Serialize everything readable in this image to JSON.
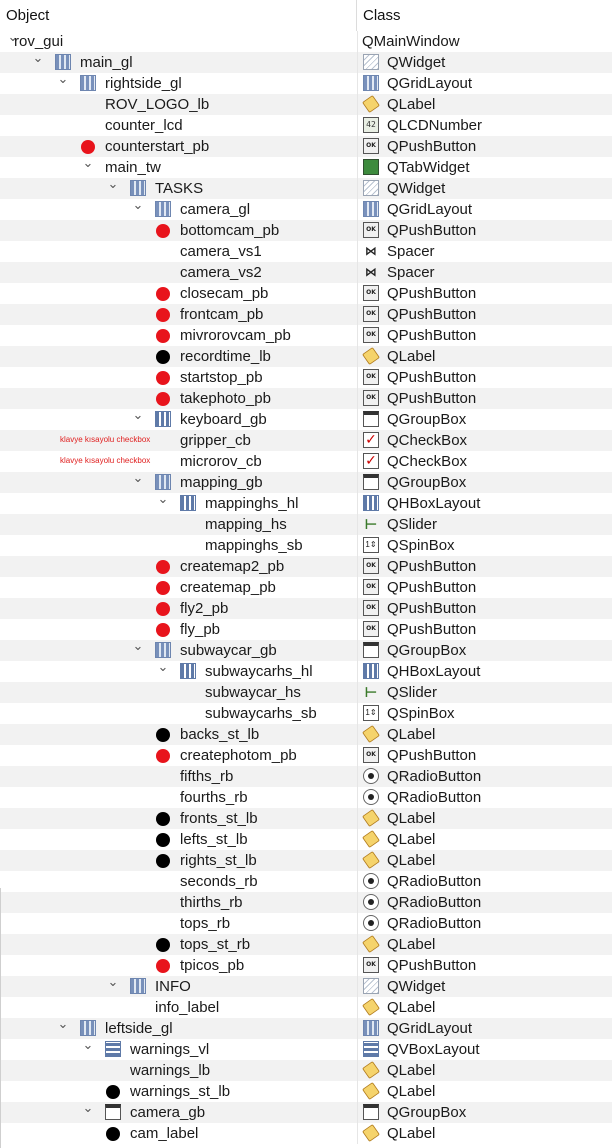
{
  "header": {
    "object_label": "Object",
    "class_label": "Class"
  },
  "colors": {
    "red_marker": "#e8141c",
    "black_marker": "#000000",
    "annotation": "#e02020"
  },
  "rows": [
    {
      "name": "rov_gui",
      "cls": "QMainWindow",
      "depth": 0,
      "expand": "v",
      "icon": "none",
      "mark": "",
      "anno": ""
    },
    {
      "name": "main_gl",
      "cls": "QWidget",
      "depth": 1,
      "expand": "v",
      "icon": "grid-layout-icon",
      "cicon": "widget",
      "mark": "",
      "anno": ""
    },
    {
      "name": "rightside_gl",
      "cls": "QGridLayout",
      "depth": 2,
      "expand": "v",
      "icon": "grid-layout-icon",
      "cicon": "grid",
      "mark": "",
      "anno": ""
    },
    {
      "name": "ROV_LOGO_lb",
      "cls": "QLabel",
      "depth": 3,
      "expand": "",
      "icon": "",
      "cicon": "label",
      "mark": "",
      "anno": ""
    },
    {
      "name": "counter_lcd",
      "cls": "QLCDNumber",
      "depth": 3,
      "expand": "",
      "icon": "",
      "cicon": "lcd",
      "mark": "",
      "anno": ""
    },
    {
      "name": "counterstart_pb",
      "cls": "QPushButton",
      "depth": 3,
      "expand": "",
      "icon": "",
      "cicon": "button",
      "mark": "red",
      "anno": ""
    },
    {
      "name": "main_tw",
      "cls": "QTabWidget",
      "depth": 3,
      "expand": "v",
      "icon": "",
      "cicon": "tab",
      "mark": "",
      "anno": ""
    },
    {
      "name": "TASKS",
      "cls": "QWidget",
      "depth": 4,
      "expand": "v",
      "icon": "grid-layout-icon",
      "cicon": "widget",
      "mark": "",
      "anno": ""
    },
    {
      "name": "camera_gl",
      "cls": "QGridLayout",
      "depth": 5,
      "expand": "v",
      "icon": "grid-layout-icon",
      "cicon": "grid",
      "mark": "",
      "anno": ""
    },
    {
      "name": "bottomcam_pb",
      "cls": "QPushButton",
      "depth": 6,
      "expand": "",
      "icon": "",
      "cicon": "button",
      "mark": "red",
      "anno": ""
    },
    {
      "name": "camera_vs1",
      "cls": "Spacer",
      "depth": 6,
      "expand": "",
      "icon": "",
      "cicon": "spacer",
      "mark": "",
      "anno": ""
    },
    {
      "name": "camera_vs2",
      "cls": "Spacer",
      "depth": 6,
      "expand": "",
      "icon": "",
      "cicon": "spacer",
      "mark": "",
      "anno": ""
    },
    {
      "name": "closecam_pb",
      "cls": "QPushButton",
      "depth": 6,
      "expand": "",
      "icon": "",
      "cicon": "button",
      "mark": "red",
      "anno": ""
    },
    {
      "name": "frontcam_pb",
      "cls": "QPushButton",
      "depth": 6,
      "expand": "",
      "icon": "",
      "cicon": "button",
      "mark": "red",
      "anno": ""
    },
    {
      "name": "mivrorovcam_pb",
      "cls": "QPushButton",
      "depth": 6,
      "expand": "",
      "icon": "",
      "cicon": "button",
      "mark": "red",
      "anno": ""
    },
    {
      "name": "recordtime_lb",
      "cls": "QLabel",
      "depth": 6,
      "expand": "",
      "icon": "",
      "cicon": "label",
      "mark": "black",
      "anno": ""
    },
    {
      "name": "startstop_pb",
      "cls": "QPushButton",
      "depth": 6,
      "expand": "",
      "icon": "",
      "cicon": "button",
      "mark": "red",
      "anno": ""
    },
    {
      "name": "takephoto_pb",
      "cls": "QPushButton",
      "depth": 6,
      "expand": "",
      "icon": "",
      "cicon": "button",
      "mark": "red",
      "anno": ""
    },
    {
      "name": "keyboard_gb",
      "cls": "QGroupBox",
      "depth": 5,
      "expand": "v",
      "icon": "hbox-layout-icon",
      "cicon": "groupbox",
      "mark": "",
      "anno": ""
    },
    {
      "name": "gripper_cb",
      "cls": "QCheckBox",
      "depth": 6,
      "expand": "",
      "icon": "",
      "cicon": "check",
      "mark": "",
      "anno": "klavye kısayolu checkbox"
    },
    {
      "name": "microrov_cb",
      "cls": "QCheckBox",
      "depth": 6,
      "expand": "",
      "icon": "",
      "cicon": "check",
      "mark": "",
      "anno": "klavye kısayolu checkbox"
    },
    {
      "name": "mapping_gb",
      "cls": "QGroupBox",
      "depth": 5,
      "expand": "v",
      "icon": "grid-layout-icon",
      "cicon": "groupbox",
      "mark": "",
      "anno": ""
    },
    {
      "name": "mappinghs_hl",
      "cls": "QHBoxLayout",
      "depth": 6,
      "expand": "v",
      "icon": "hbox-layout-icon",
      "cicon": "hbox",
      "mark": "",
      "anno": ""
    },
    {
      "name": "mapping_hs",
      "cls": "QSlider",
      "depth": 7,
      "expand": "",
      "icon": "",
      "cicon": "slider",
      "mark": "",
      "anno": ""
    },
    {
      "name": "mappinghs_sb",
      "cls": "QSpinBox",
      "depth": 7,
      "expand": "",
      "icon": "",
      "cicon": "spin",
      "mark": "",
      "anno": ""
    },
    {
      "name": "createmap2_pb",
      "cls": "QPushButton",
      "depth": 6,
      "expand": "",
      "icon": "",
      "cicon": "button",
      "mark": "red",
      "anno": ""
    },
    {
      "name": "createmap_pb",
      "cls": "QPushButton",
      "depth": 6,
      "expand": "",
      "icon": "",
      "cicon": "button",
      "mark": "red",
      "anno": ""
    },
    {
      "name": "fly2_pb",
      "cls": "QPushButton",
      "depth": 6,
      "expand": "",
      "icon": "",
      "cicon": "button",
      "mark": "red",
      "anno": ""
    },
    {
      "name": "fly_pb",
      "cls": "QPushButton",
      "depth": 6,
      "expand": "",
      "icon": "",
      "cicon": "button",
      "mark": "red",
      "anno": ""
    },
    {
      "name": "subwaycar_gb",
      "cls": "QGroupBox",
      "depth": 5,
      "expand": "v",
      "icon": "grid-layout-icon",
      "cicon": "groupbox",
      "mark": "",
      "anno": ""
    },
    {
      "name": "subwaycarhs_hl",
      "cls": "QHBoxLayout",
      "depth": 6,
      "expand": "v",
      "icon": "hbox-layout-icon",
      "cicon": "hbox",
      "mark": "",
      "anno": ""
    },
    {
      "name": "subwaycar_hs",
      "cls": "QSlider",
      "depth": 7,
      "expand": "",
      "icon": "",
      "cicon": "slider",
      "mark": "",
      "anno": ""
    },
    {
      "name": "subwaycarhs_sb",
      "cls": "QSpinBox",
      "depth": 7,
      "expand": "",
      "icon": "",
      "cicon": "spin",
      "mark": "",
      "anno": ""
    },
    {
      "name": "backs_st_lb",
      "cls": "QLabel",
      "depth": 6,
      "expand": "",
      "icon": "",
      "cicon": "label",
      "mark": "black",
      "anno": ""
    },
    {
      "name": "createphotom_pb",
      "cls": "QPushButton",
      "depth": 6,
      "expand": "",
      "icon": "",
      "cicon": "button",
      "mark": "red",
      "anno": ""
    },
    {
      "name": "fifths_rb",
      "cls": "QRadioButton",
      "depth": 6,
      "expand": "",
      "icon": "",
      "cicon": "radio",
      "mark": "",
      "anno": ""
    },
    {
      "name": "fourths_rb",
      "cls": "QRadioButton",
      "depth": 6,
      "expand": "",
      "icon": "",
      "cicon": "radio",
      "mark": "",
      "anno": ""
    },
    {
      "name": "fronts_st_lb",
      "cls": "QLabel",
      "depth": 6,
      "expand": "",
      "icon": "",
      "cicon": "label",
      "mark": "black",
      "anno": ""
    },
    {
      "name": "lefts_st_lb",
      "cls": "QLabel",
      "depth": 6,
      "expand": "",
      "icon": "",
      "cicon": "label",
      "mark": "black",
      "anno": ""
    },
    {
      "name": "rights_st_lb",
      "cls": "QLabel",
      "depth": 6,
      "expand": "",
      "icon": "",
      "cicon": "label",
      "mark": "black",
      "anno": ""
    },
    {
      "name": "seconds_rb",
      "cls": "QRadioButton",
      "depth": 6,
      "expand": "",
      "icon": "",
      "cicon": "radio",
      "mark": "",
      "anno": ""
    },
    {
      "name": "thirths_rb",
      "cls": "QRadioButton",
      "depth": 6,
      "expand": "",
      "icon": "",
      "cicon": "radio",
      "mark": "",
      "anno": ""
    },
    {
      "name": "tops_rb",
      "cls": "QRadioButton",
      "depth": 6,
      "expand": "",
      "icon": "",
      "cicon": "radio",
      "mark": "",
      "anno": ""
    },
    {
      "name": "tops_st_rb",
      "cls": "QLabel",
      "depth": 6,
      "expand": "",
      "icon": "",
      "cicon": "label",
      "mark": "black",
      "anno": ""
    },
    {
      "name": "tpicos_pb",
      "cls": "QPushButton",
      "depth": 6,
      "expand": "",
      "icon": "",
      "cicon": "button",
      "mark": "red",
      "anno": ""
    },
    {
      "name": "INFO",
      "cls": "QWidget",
      "depth": 4,
      "expand": "v",
      "icon": "grid-layout-icon",
      "cicon": "widget",
      "mark": "",
      "anno": ""
    },
    {
      "name": "info_label",
      "cls": "QLabel",
      "depth": 5,
      "expand": "",
      "icon": "",
      "cicon": "label",
      "mark": "",
      "anno": ""
    },
    {
      "name": "leftside_gl",
      "cls": "QGridLayout",
      "depth": 2,
      "expand": "v",
      "icon": "grid-layout-icon",
      "cicon": "grid",
      "mark": "",
      "anno": ""
    },
    {
      "name": "warnings_vl",
      "cls": "QVBoxLayout",
      "depth": 3,
      "expand": "v",
      "icon": "vbox-layout-icon",
      "cicon": "vbox",
      "mark": "",
      "anno": ""
    },
    {
      "name": "warnings_lb",
      "cls": "QLabel",
      "depth": 4,
      "expand": "",
      "icon": "",
      "cicon": "label",
      "mark": "",
      "anno": ""
    },
    {
      "name": "warnings_st_lb",
      "cls": "QLabel",
      "depth": 4,
      "expand": "",
      "icon": "",
      "cicon": "label",
      "mark": "black",
      "anno": ""
    },
    {
      "name": "camera_gb",
      "cls": "QGroupBox",
      "depth": 3,
      "expand": "v",
      "icon": "groupbox-icon",
      "cicon": "groupbox",
      "mark": "",
      "anno": ""
    },
    {
      "name": "cam_label",
      "cls": "QLabel",
      "depth": 4,
      "expand": "",
      "icon": "",
      "cicon": "label",
      "mark": "black",
      "anno": ""
    }
  ]
}
